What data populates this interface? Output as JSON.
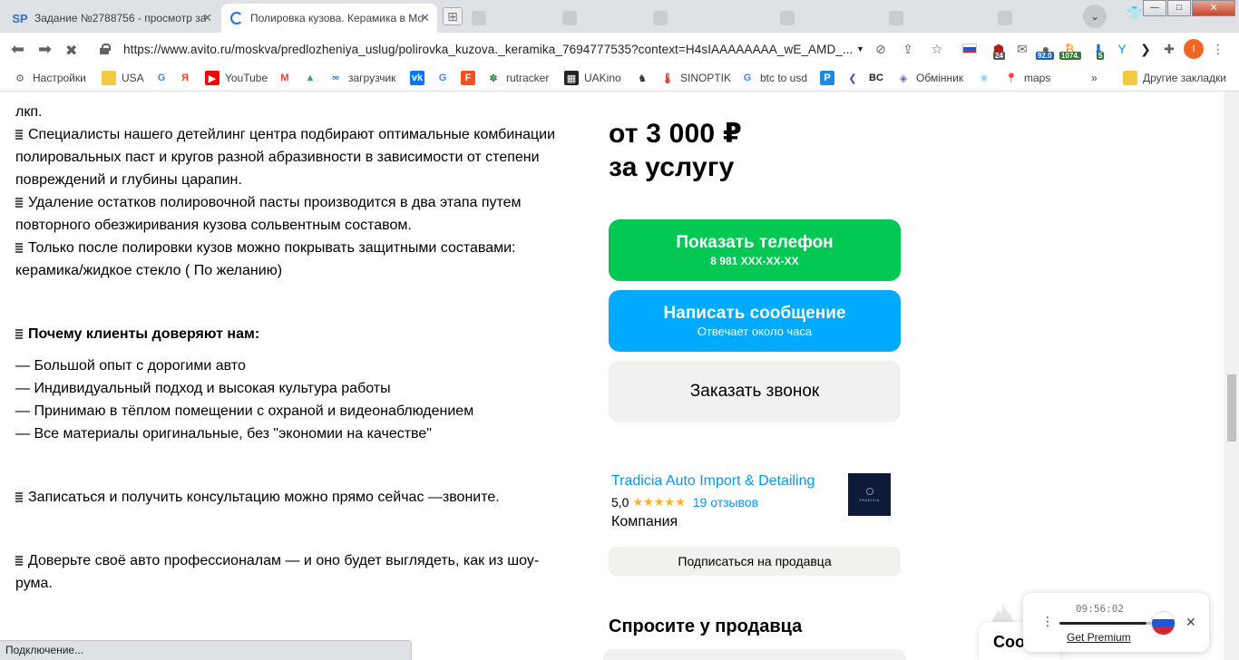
{
  "browser": {
    "tabs": [
      {
        "label": "Задание №2788756 - просмотр за",
        "icon": "sp-favicon"
      },
      {
        "label": "Полировка кузова. Керамика в Мо",
        "icon": "loading-spinner",
        "active": true
      }
    ],
    "ghost_tabs": [
      "",
      ""
    ],
    "profile_initial": "",
    "window_controls": {
      "minimize": "—",
      "maximize": "□",
      "close": "✕"
    },
    "url": "https://www.avito.ru/moskva/predlozheniya_uslug/polirovka_kuzova._keramika_7694777535?context=H4sIAAAAAAAA_wE_AMD_...",
    "extension_badges": {
      "b1": "24",
      "b2": "92.0",
      "b3": "1074.",
      "b4": "5"
    },
    "avatar_initial": "I"
  },
  "bookmarks": [
    {
      "label": "Настройки",
      "icon": "gear-icon",
      "color": "#5f6368"
    },
    {
      "label": "USA",
      "icon": "folder-icon",
      "color": "#f5c842"
    },
    {
      "label": "",
      "icon": "google-icon",
      "color": "#4285f4"
    },
    {
      "label": "",
      "icon": "yandex-icon",
      "color": "#fc3f1d"
    },
    {
      "label": "YouTube",
      "icon": "youtube-icon",
      "color": "#ff0000"
    },
    {
      "label": "",
      "icon": "gmail-icon",
      "color": "#ea4335"
    },
    {
      "label": "",
      "icon": "drive-icon",
      "color": "#34a853"
    },
    {
      "label": "загрузчик",
      "icon": "infinity-icon",
      "color": "#1a73e8"
    },
    {
      "label": "",
      "icon": "vk-icon",
      "color": "#0077ff"
    },
    {
      "label": "",
      "icon": "translate-icon",
      "color": "#4285f4"
    },
    {
      "label": "",
      "icon": "f-icon",
      "color": "#f4511e"
    },
    {
      "label": "rutracker",
      "icon": "rutracker-icon",
      "color": "#2e7d32"
    },
    {
      "label": "UAKino",
      "icon": "uakino-icon",
      "color": "#222222"
    },
    {
      "label": "",
      "icon": "chess-icon",
      "color": "#333333"
    },
    {
      "label": "SINOPTIK",
      "icon": "thermometer-icon",
      "color": "#d32f2f"
    },
    {
      "label": "btc to usd",
      "icon": "google-icon",
      "color": "#4285f4"
    },
    {
      "label": "",
      "icon": "p-icon",
      "color": "#1e88e5"
    },
    {
      "label": "",
      "icon": "arrow-icon",
      "color": "#3949ab"
    },
    {
      "label": "",
      "icon": "bc-icon",
      "color": "#222222"
    },
    {
      "label": "Обмінник",
      "icon": "diamond-icon",
      "color": "#5c6bc0"
    },
    {
      "label": "",
      "icon": "snowflake-icon",
      "color": "#29b6f6"
    },
    {
      "label": "maps",
      "icon": "maps-pin-icon",
      "color": "#34a853"
    }
  ],
  "bookmarks_more": "»",
  "other_bookmarks": "Другие закладки",
  "listing": {
    "description_lines": [
      "лкп.",
      "Специалисты нашего детейлинг центра подбирают оптимальные комбинации полировальных паст и кругов разной абразивности в зависимости от степени повреждений и глубины царапин.",
      "Удаление остатков полировочной пасты производится в два этапа путем повторного обезжиривания кузова сольвентным составом.",
      "Только после полировки кузов можно покрывать защитными составами: керамика/жидкое стекло ( По желанию)"
    ],
    "why_title": "Почему клиенты доверяют нам:",
    "why_items": [
      "— Большой опыт с дорогими авто",
      "— Индивидуальный подход и высокая культура работы",
      "— Принимаю в тёплом помещении с охраной и видеонаблюдением",
      "— Все материалы оригинальные, без \"экономии на качестве\""
    ],
    "cta_line": "Записаться и получить консультацию можно прямо сейчас —звоните.",
    "trust_line": "Доверьте своё авто профессионалам — и оно будет выглядеть, как из шоу-рума."
  },
  "sidebar": {
    "price_line1": "от 3 000 ₽",
    "price_line2": "за услугу",
    "show_phone": "Показать телефон",
    "phone_masked": "8 981 XXX-XX-XX",
    "write_message": "Написать сообщение",
    "reply_time": "Отвечает около часа",
    "order_call": "Заказать звонок",
    "seller_name": "Tradicia Auto Import & Detailing",
    "rating": "5,0",
    "stars": "★★★★★",
    "reviews": "19 отзывов",
    "seller_type": "Компания",
    "subscribe": "Подписаться на продавца",
    "ask_title": "Спросите у продавца",
    "logo_text": "TRADICIA"
  },
  "status_text": "Подключение...",
  "chat_tab_label": "Сооб",
  "recorder": {
    "time": "09:56:02",
    "premium": "Get Premium"
  },
  "colors": {
    "phone_button": "#00c853",
    "message_button": "#00aaff",
    "link": "#0099f7",
    "star": "#ffb021"
  }
}
